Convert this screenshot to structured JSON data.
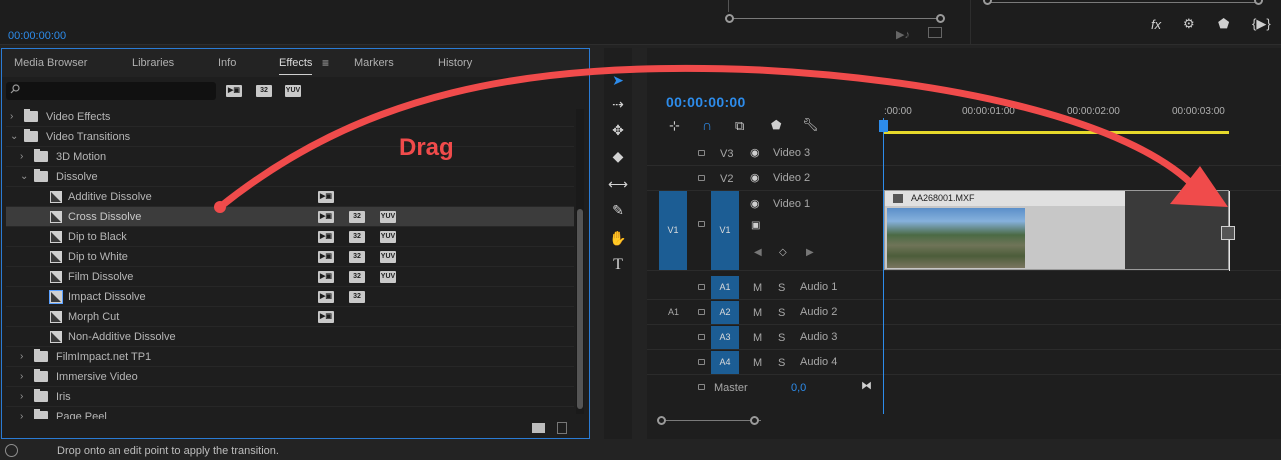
{
  "program_monitor": {
    "timecode": "00:00:00:00"
  },
  "effects_panel": {
    "tabs": [
      "Media Browser",
      "Libraries",
      "Info",
      "Effects",
      "Markers",
      "History"
    ],
    "active_tab": "Effects",
    "tab_menu_glyph": "≡",
    "search_placeholder": "",
    "filter_badges": [
      "accelerated-effects-icon",
      "32-bit-icon",
      "yuv-icon"
    ],
    "tree": [
      {
        "level": 0,
        "type": "folder",
        "expanded": false,
        "label": "Video Effects"
      },
      {
        "level": 0,
        "type": "folder",
        "expanded": true,
        "label": "Video Transitions"
      },
      {
        "level": 1,
        "type": "folder",
        "expanded": false,
        "label": "3D Motion"
      },
      {
        "level": 1,
        "type": "folder",
        "expanded": true,
        "label": "Dissolve"
      },
      {
        "level": 2,
        "type": "transition",
        "label": "Additive Dissolve",
        "badges": [
          "acc"
        ]
      },
      {
        "level": 2,
        "type": "transition",
        "label": "Cross Dissolve",
        "badges": [
          "acc",
          "32",
          "yuv"
        ],
        "selected": true
      },
      {
        "level": 2,
        "type": "transition",
        "label": "Dip to Black",
        "badges": [
          "acc",
          "32",
          "yuv"
        ]
      },
      {
        "level": 2,
        "type": "transition",
        "label": "Dip to White",
        "badges": [
          "acc",
          "32",
          "yuv"
        ]
      },
      {
        "level": 2,
        "type": "transition",
        "label": "Film Dissolve",
        "badges": [
          "acc",
          "32",
          "yuv"
        ]
      },
      {
        "level": 2,
        "type": "transition",
        "label": "Impact Dissolve",
        "badges": [
          "acc",
          "32"
        ],
        "impact": true
      },
      {
        "level": 2,
        "type": "transition",
        "label": "Morph Cut",
        "badges": [
          "acc"
        ]
      },
      {
        "level": 2,
        "type": "transition",
        "label": "Non-Additive Dissolve",
        "badges": []
      },
      {
        "level": 1,
        "type": "folder",
        "expanded": false,
        "label": "FilmImpact.net TP1"
      },
      {
        "level": 1,
        "type": "folder",
        "expanded": false,
        "label": "Immersive Video"
      },
      {
        "level": 1,
        "type": "folder",
        "expanded": false,
        "label": "Iris"
      },
      {
        "level": 1,
        "type": "folder",
        "expanded": false,
        "label": "Page Peel"
      }
    ]
  },
  "timeline": {
    "timecode": "00:00:00:00",
    "ruler_labels": [
      ":00:00",
      "00:00:01:00",
      "00:00:02:00",
      "00:00:03:00"
    ],
    "video_tracks": [
      {
        "id": "V3",
        "name": "Video 3"
      },
      {
        "id": "V2",
        "name": "Video 2"
      },
      {
        "id": "V1",
        "name": "Video 1",
        "source": "V1"
      }
    ],
    "audio_tracks": [
      {
        "id": "A1",
        "name": "Audio 1",
        "source": ""
      },
      {
        "id": "A2",
        "name": "Audio 2",
        "source": "A1"
      },
      {
        "id": "A3",
        "name": "Audio 3",
        "source": ""
      },
      {
        "id": "A4",
        "name": "Audio 4",
        "source": ""
      }
    ],
    "mute_label": "M",
    "solo_label": "S",
    "master_label": "Master",
    "master_value": "0,0",
    "clip_name": "AA268001.MXF"
  },
  "annotation": {
    "label": "Drag",
    "color": "#f04b4b"
  },
  "status_bar": {
    "text": "Drop onto an edit point to apply the transition."
  },
  "colors": {
    "accent_blue": "#2d8ceb",
    "track_target_blue": "#1c5d94",
    "work_area_yellow": "#e6d92b"
  }
}
